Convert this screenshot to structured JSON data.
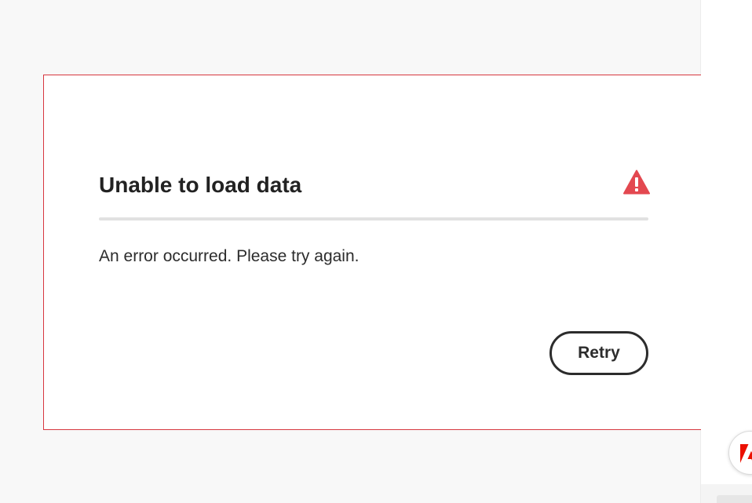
{
  "error_card": {
    "title": "Unable to load data",
    "message": "An error occurred. Please try again.",
    "retry_label": "Retry",
    "icon": "alert-triangle-icon"
  },
  "floating_button": {
    "icon": "adobe-logo-icon"
  },
  "colors": {
    "page_background": "#f8f8f8",
    "card_border": "#d7373f",
    "alert_icon": "#e34850",
    "adobe_red": "#eb1000",
    "text": "#2c2c2c",
    "divider": "#e1e1e1"
  }
}
